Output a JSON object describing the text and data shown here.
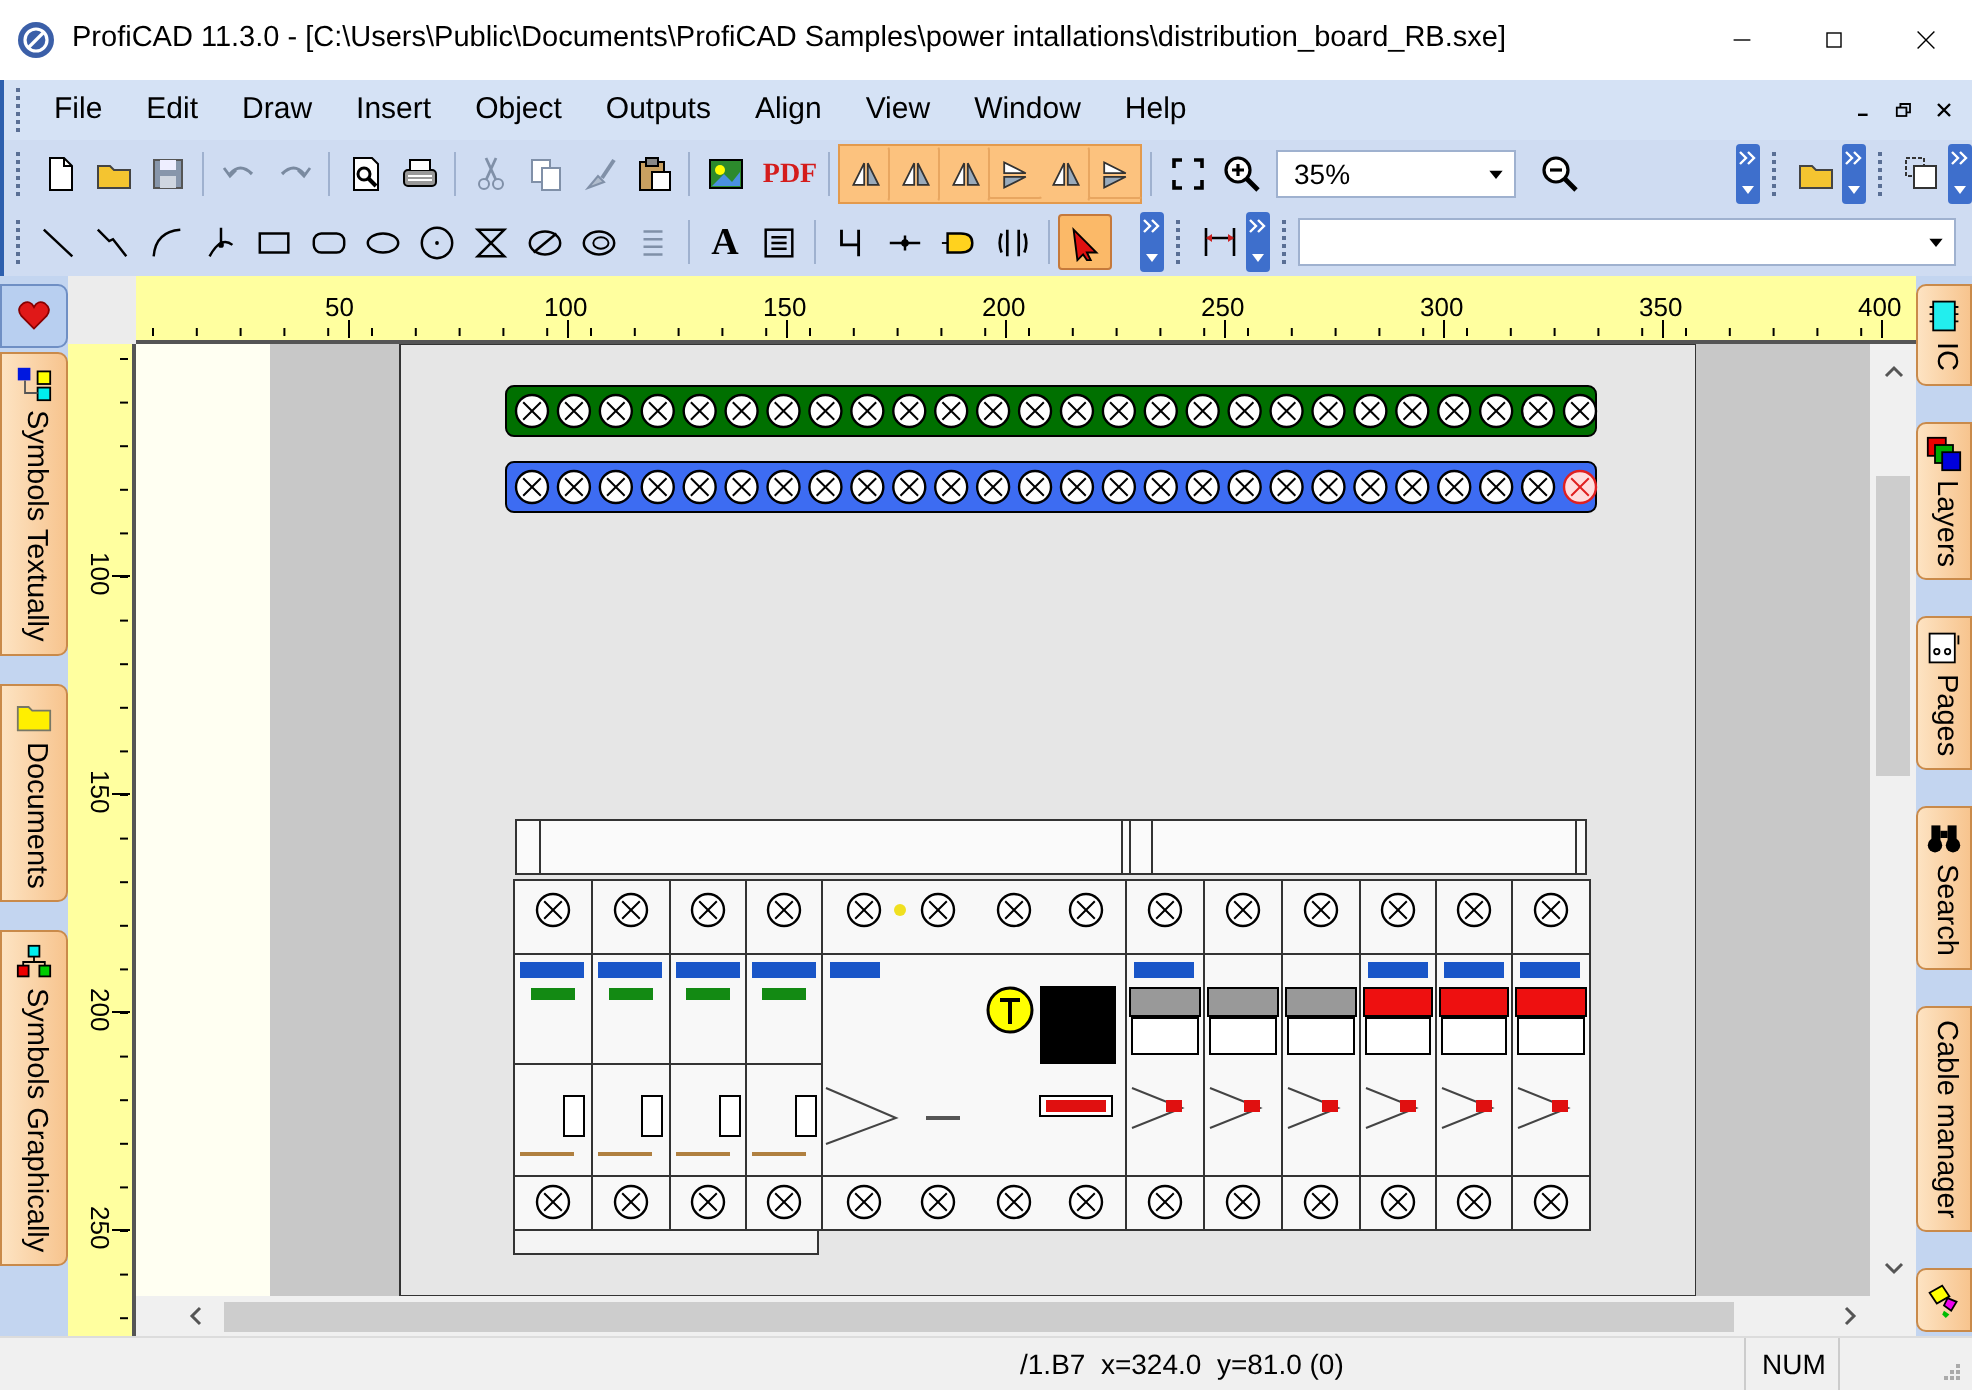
{
  "window": {
    "title": "ProfiCAD 11.3.0 - [C:\\Users\\Public\\Documents\\ProfiCAD Samples\\power intallations\\distribution_board_RB.sxe]"
  },
  "menu": [
    "File",
    "Edit",
    "Draw",
    "Insert",
    "Object",
    "Outputs",
    "Align",
    "View",
    "Window",
    "Help"
  ],
  "main_toolbar": {
    "pdf_label": "PDF",
    "zoom": "35%"
  },
  "draw_tools": [
    {
      "kind": "line",
      "selected": false
    },
    {
      "kind": "polyline",
      "selected": false
    },
    {
      "kind": "arc",
      "selected": false
    },
    {
      "kind": "curve",
      "selected": false
    },
    {
      "kind": "rectangle",
      "selected": false
    },
    {
      "kind": "rounded",
      "selected": false
    },
    {
      "kind": "ellipse",
      "selected": false
    },
    {
      "kind": "circle",
      "selected": false
    },
    {
      "kind": "hourglass",
      "selected": false
    },
    {
      "kind": "slashed",
      "selected": false
    },
    {
      "kind": "rings",
      "selected": false
    },
    {
      "kind": "list",
      "selected": false
    },
    {
      "kind": "text",
      "glyph": "A",
      "selected": false
    },
    {
      "kind": "textbox",
      "selected": false
    },
    {
      "kind": "wire",
      "selected": false
    },
    {
      "kind": "junction",
      "selected": false
    },
    {
      "kind": "connector",
      "selected": false
    },
    {
      "kind": "bus",
      "selected": false
    },
    {
      "kind": "pointer",
      "selected": true
    }
  ],
  "rulers": {
    "horizontal": [
      "50",
      "100",
      "150",
      "200",
      "250",
      "300",
      "350",
      "400"
    ],
    "vertical": [
      "100",
      "150",
      "200",
      "250"
    ]
  },
  "left_dock": [
    {
      "kind": "favorites",
      "selected": true
    },
    {
      "kind": "symbols",
      "label": "Symbols Textually",
      "selected": false
    },
    {
      "kind": "folder",
      "label": "Documents",
      "selected": false
    },
    {
      "kind": "tree",
      "label": "Symbols Graphically",
      "selected": false
    }
  ],
  "right_dock": [
    {
      "kind": "chip",
      "label": "IC",
      "selected": false
    },
    {
      "kind": "layers",
      "label": "Layers",
      "selected": false
    },
    {
      "kind": "pages",
      "label": "Pages",
      "selected": false
    },
    {
      "kind": "binoculars",
      "label": "Search",
      "selected": false
    },
    {
      "kind": "cable",
      "label": "Cable manager",
      "selected": false
    },
    {
      "kind": "tags",
      "selected": false
    }
  ],
  "status_bar": {
    "position": "/1.B7  x=324.0  y=81.0 (0)",
    "num": "NUM"
  }
}
